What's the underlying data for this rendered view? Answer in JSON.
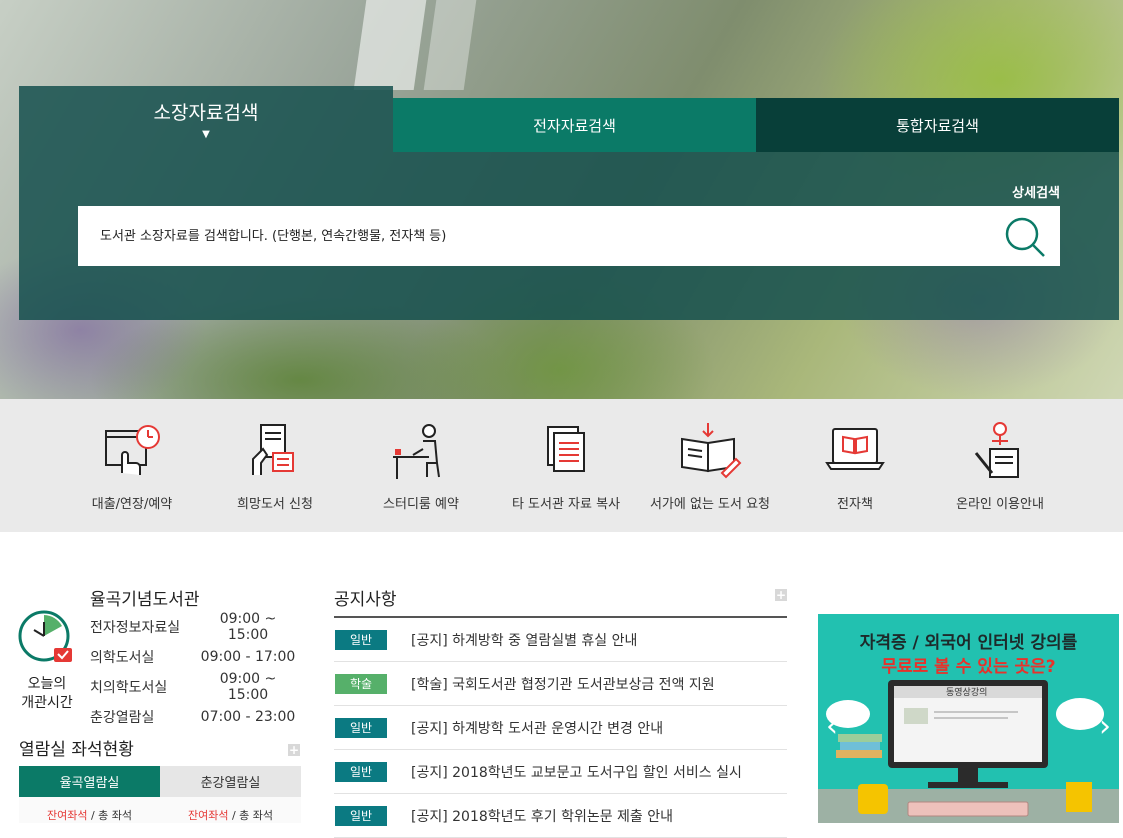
{
  "search": {
    "tabs": [
      "소장자료검색",
      "전자자료검색",
      "통합자료검색"
    ],
    "detail_link": "상세검색",
    "placeholder": "도서관 소장자료를 검색합니다. (단행본, 연속간행물, 전자책 등)",
    "active_marker": "▼"
  },
  "quick_menu": [
    {
      "label": "대출/연장/예약",
      "icon": "loan-clock-icon"
    },
    {
      "label": "희망도서 신청",
      "icon": "book-request-icon"
    },
    {
      "label": "스터디룸 예약",
      "icon": "study-room-icon"
    },
    {
      "label": "타 도서관 자료 복사",
      "icon": "copy-document-icon"
    },
    {
      "label": "서가에 없는 도서 요청",
      "icon": "open-book-icon"
    },
    {
      "label": "전자책",
      "icon": "ebook-icon"
    },
    {
      "label": "온라인 이용안내",
      "icon": "online-guide-icon"
    }
  ],
  "hours": {
    "library_name": "율곡기념도서관",
    "label_line1": "오늘의",
    "label_line2": "개관시간",
    "rows": [
      {
        "name": "전자정보자료실",
        "time": "09:00 ~ 15:00"
      },
      {
        "name": "의학도서실",
        "time": "09:00 - 17:00"
      },
      {
        "name": "치의학도서실",
        "time": "09:00 ~ 15:00"
      },
      {
        "name": "춘강열람실",
        "time": "07:00 - 23:00"
      }
    ]
  },
  "seats": {
    "title": "열람실 좌석현황",
    "more": "+",
    "tabs": [
      "율곡열람실",
      "춘강열람실"
    ],
    "remaining_label": "잔여좌석",
    "total_label": "/ 총 좌석"
  },
  "notices": {
    "title": "공지사항",
    "more": "+",
    "items": [
      {
        "badge": "일반",
        "type": "general",
        "text": "[공지] 하계방학 중 열람실별 휴실 안내"
      },
      {
        "badge": "학술",
        "type": "academic",
        "text": "[학술] 국회도서관 협정기관 도서관보상금 전액 지원"
      },
      {
        "badge": "일반",
        "type": "general",
        "text": "[공지] 하계방학 도서관 운영시간 변경 안내"
      },
      {
        "badge": "일반",
        "type": "general",
        "text": "[공지] 2018학년도 교보문고 도서구입 할인 서비스 실시"
      },
      {
        "badge": "일반",
        "type": "general",
        "text": "[공지] 2018학년도 후기 학위논문 제출 안내"
      }
    ]
  },
  "banner": {
    "line1": "자격증 / 외국어 인터넷 강의를",
    "line2": "무료로 볼 수 있는 곳은?",
    "screen_title": "동영상강의",
    "prev": "‹",
    "next": "›"
  },
  "colors": {
    "primary": "#0b7a67",
    "dark": "#083f39",
    "panel": "#16504e",
    "accent_red": "#e53935"
  }
}
